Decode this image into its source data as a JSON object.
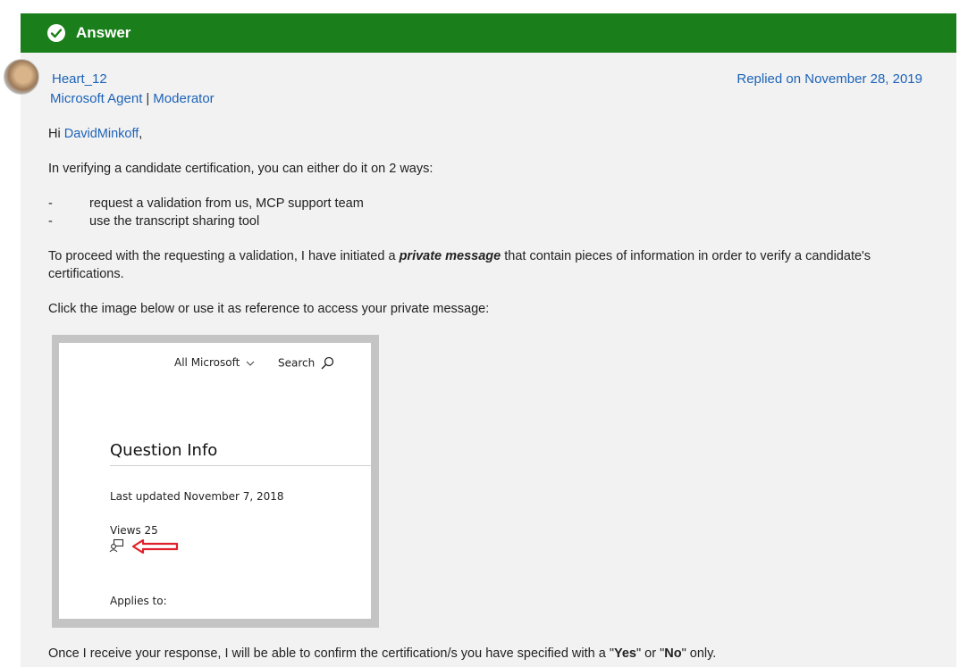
{
  "answer_bar": {
    "label": "Answer"
  },
  "post": {
    "username": "Heart_12",
    "role_agent": "Microsoft Agent",
    "role_separator": "|",
    "role_moderator": "Moderator",
    "replied": "Replied on November 28, 2019",
    "greeting_prefix": "Hi ",
    "mention": "DavidMinkoff",
    "greeting_suffix": ",",
    "para1": "In verifying a candidate certification, you can either do it on 2 ways:",
    "bullets": [
      {
        "dash": "-",
        "text": "request a validation from us, MCP support team"
      },
      {
        "dash": "-",
        "text": "use the transcript sharing tool"
      }
    ],
    "para2_before": "To proceed with the requesting a validation, I have initiated a ",
    "para2_emphasis": "private message",
    "para2_after": " that contain pieces of information in order to verify a candidate's",
    "para2_line2": "certifications.",
    "para3": "Click the image below or use it as reference to access your private message:",
    "para4_a": "Once I receive your response, I will be able to confirm the certification/s you have specified with a \"",
    "para4_yes": "Yes",
    "para4_b": "\" or \"",
    "para4_no": "No",
    "para4_c": "\" only."
  },
  "embedded_image": {
    "all_microsoft": "All Microsoft",
    "search": "Search",
    "title": "Question Info",
    "last_updated": "Last updated November 7, 2018",
    "views": "Views 25",
    "applies_to": "Applies to:",
    "arrow_color": "#e0202a"
  },
  "colors": {
    "answer_green": "#1a7f1a",
    "link_blue": "#1d63b8",
    "post_bg": "#f2f2f2"
  }
}
